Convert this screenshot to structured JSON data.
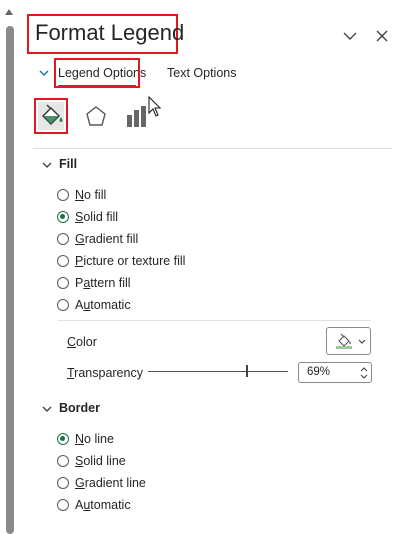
{
  "pane": {
    "title": "Format Legend"
  },
  "tabs": [
    {
      "label": "Legend Options"
    },
    {
      "label": "Text Options"
    }
  ],
  "categories": [
    "fill-line-icon",
    "effects-icon",
    "size-properties-icon"
  ],
  "fill_section": {
    "label": "Fill",
    "options": [
      {
        "label": "No fill",
        "mnemonic": "N",
        "rest": "o fill",
        "selected": false
      },
      {
        "label": "Solid fill",
        "mnemonic": "S",
        "rest": "olid fill",
        "selected": true
      },
      {
        "label": "Gradient fill",
        "mnemonic": "G",
        "rest": "radient fill",
        "selected": false
      },
      {
        "label": "Picture or texture fill",
        "mnemonic": "P",
        "rest": "icture or texture fill",
        "selected": false
      },
      {
        "label": "Pattern fill",
        "mnemonic": "A",
        "pre": "P",
        "rest": "ttern fill",
        "selected": false
      },
      {
        "label": "Automatic",
        "mnemonic": "U",
        "pre": "A",
        "rest": "tomatic",
        "selected": false
      }
    ],
    "color_label": "Color",
    "color_mnemonic": "C",
    "color_rest": "olor",
    "transparency_label": "Transparency",
    "transparency_mnemonic": "T",
    "transparency_rest": "ransparency",
    "transparency_value": "69%",
    "transparency_level": 0.69
  },
  "border_section": {
    "label": "Border",
    "options": [
      {
        "label": "No line",
        "mnemonic": "N",
        "rest": "o line",
        "selected": true
      },
      {
        "label": "Solid line",
        "mnemonic": "S",
        "rest": "olid line",
        "selected": false
      },
      {
        "label": "Gradient line",
        "mnemonic": "G",
        "rest": "radient line",
        "selected": false
      },
      {
        "label": "Automatic",
        "mnemonic": "U",
        "pre": "A",
        "rest": "tomatic",
        "selected": false
      }
    ]
  },
  "colors": {
    "highlight": "#e0191f",
    "accent": "#1f6bb5",
    "radio_selected": "#1e7145"
  }
}
